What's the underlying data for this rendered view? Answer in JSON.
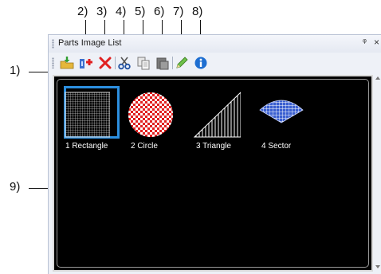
{
  "callouts": [
    "1)",
    "2)",
    "3)",
    "4)",
    "5)",
    "6)",
    "7)",
    "8)",
    "9)"
  ],
  "panel": {
    "title": "Parts Image List",
    "pin_glyph": "ᵠ",
    "close_glyph": "×"
  },
  "toolbar": {
    "buttons": [
      {
        "icon": "import-folder-icon"
      },
      {
        "icon": "add-part-icon"
      },
      {
        "icon": "delete-icon"
      },
      {
        "icon": "cut-icon"
      },
      {
        "icon": "copy-icon"
      },
      {
        "icon": "paste-icon"
      },
      {
        "icon": "edit-pencil-icon"
      },
      {
        "icon": "info-icon"
      }
    ]
  },
  "images": [
    {
      "label": "1 Rectangle",
      "selected": true
    },
    {
      "label": "2 Circle",
      "selected": false
    },
    {
      "label": "3 Triangle",
      "selected": false
    },
    {
      "label": "4 Sector",
      "selected": false
    }
  ],
  "colors": {
    "selection": "#2c8fe0",
    "circle_fill": "#e02020",
    "sector_fill": "#3a5fd0",
    "delete_red": "#e02020"
  }
}
